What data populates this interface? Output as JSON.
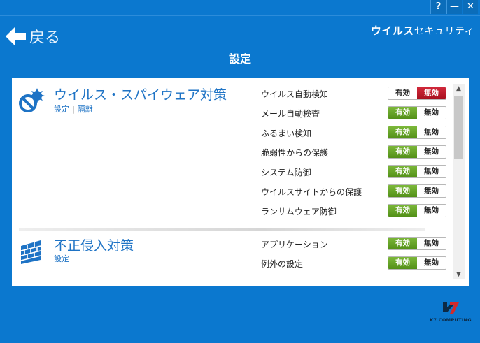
{
  "window_controls": {
    "help": "?",
    "minimize": "—",
    "close": "✕"
  },
  "header": {
    "back_label": "戻る",
    "brand_bold": "ウイルス",
    "brand_thin": "セキュリティ",
    "page_title": "設定"
  },
  "sections": [
    {
      "title": "ウイルス・スパイウェア対策",
      "icon": "antivirus-shield-icon",
      "links": [
        "設定",
        "隔離"
      ],
      "link_separator": "|",
      "items": [
        {
          "label": "ウイルス自動検知",
          "on": "有効",
          "off": "無効",
          "state": "off"
        },
        {
          "label": "メール自動検査",
          "on": "有効",
          "off": "無効",
          "state": "on"
        },
        {
          "label": "ふるまい検知",
          "on": "有効",
          "off": "無効",
          "state": "on"
        },
        {
          "label": "脆弱性からの保護",
          "on": "有効",
          "off": "無効",
          "state": "on"
        },
        {
          "label": "システム防御",
          "on": "有効",
          "off": "無効",
          "state": "on"
        },
        {
          "label": "ウイルスサイトからの保護",
          "on": "有効",
          "off": "無効",
          "state": "on"
        },
        {
          "label": "ランサムウェア防御",
          "on": "有効",
          "off": "無効",
          "state": "on"
        }
      ]
    },
    {
      "title": "不正侵入対策",
      "icon": "firewall-icon",
      "links": [
        "設定"
      ],
      "items": [
        {
          "label": "アプリケーション",
          "on": "有効",
          "off": "無効",
          "state": "on"
        },
        {
          "label": "例外の設定",
          "on": "有効",
          "off": "無効",
          "state": "on"
        }
      ]
    }
  ],
  "scrollbar": {
    "up": "▲",
    "down": "▼"
  },
  "footer": {
    "logo_text": "K7 COMPUTING"
  },
  "colors": {
    "background": "#0B78CF",
    "enabled": "#5FA023",
    "disabled": "#C01B2C",
    "section_title": "#1E73C5"
  }
}
